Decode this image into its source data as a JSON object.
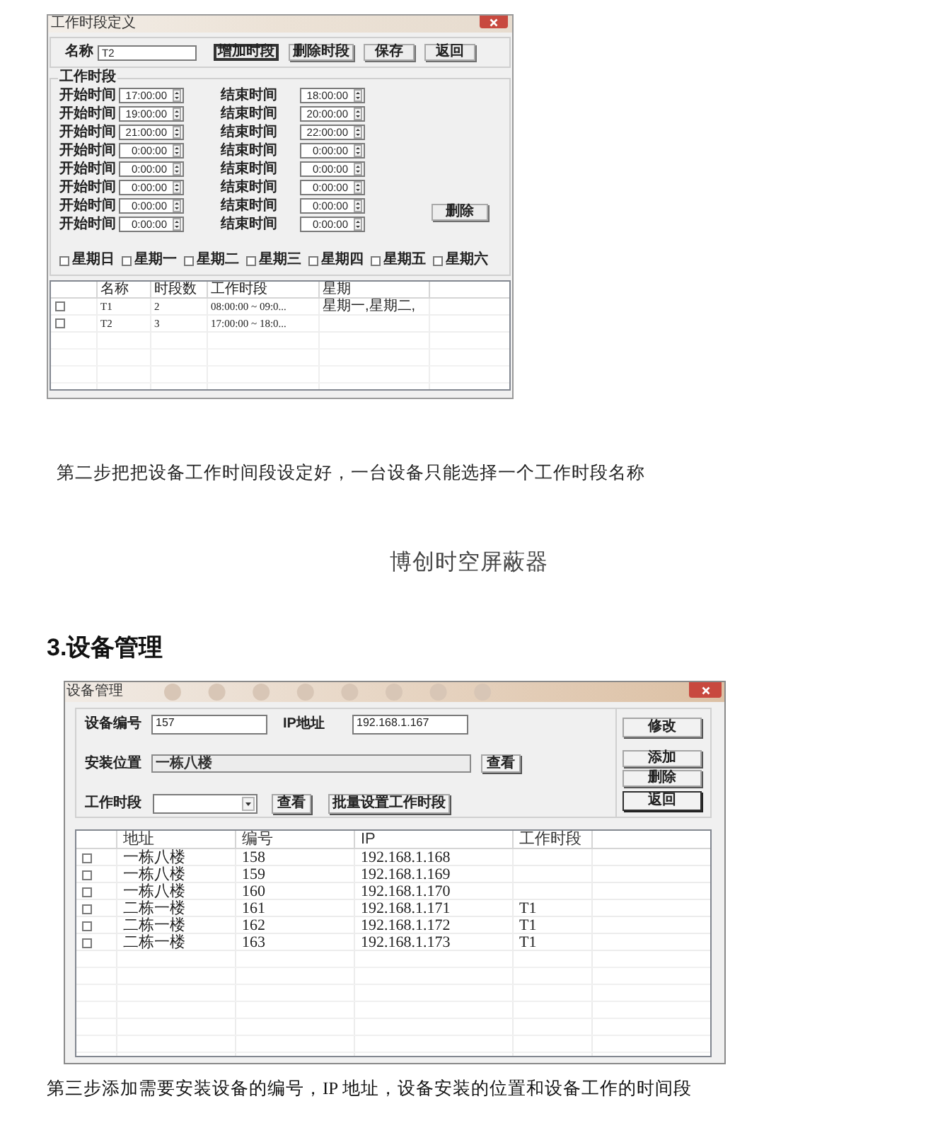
{
  "period_dialog": {
    "title": "工作时段定义",
    "name_label": "名称",
    "name_value": "T2",
    "buttons": [
      {
        "label": "增加时段",
        "default": true
      },
      {
        "label": "删除时段",
        "default": false
      },
      {
        "label": "保存",
        "default": false
      },
      {
        "label": "返回",
        "default": false
      }
    ],
    "group_title": "工作时段",
    "periods": [
      {
        "start_label": "开始时间",
        "start": "17:00:00",
        "end_label": "结束时间",
        "end": "18:00:00"
      },
      {
        "start_label": "开始时间",
        "start": "19:00:00",
        "end_label": "结束时间",
        "end": "20:00:00"
      },
      {
        "start_label": "开始时间",
        "start": "21:00:00",
        "end_label": "结束时间",
        "end": "22:00:00"
      },
      {
        "start_label": "开始时间",
        "start": "0:00:00",
        "end_label": "结束时间",
        "end": "0:00:00"
      },
      {
        "start_label": "开始时间",
        "start": "0:00:00",
        "end_label": "结束时间",
        "end": "0:00:00"
      },
      {
        "start_label": "开始时间",
        "start": "0:00:00",
        "end_label": "结束时间",
        "end": "0:00:00"
      },
      {
        "start_label": "开始时间",
        "start": "0:00:00",
        "end_label": "结束时间",
        "end": "0:00:00"
      },
      {
        "start_label": "开始时间",
        "start": "0:00:00",
        "end_label": "结束时间",
        "end": "0:00:00"
      }
    ],
    "delete_button": "删除",
    "weekdays": [
      {
        "label": "星期日",
        "checked": false
      },
      {
        "label": "星期一",
        "checked": false
      },
      {
        "label": "星期二",
        "checked": false
      },
      {
        "label": "星期三",
        "checked": false
      },
      {
        "label": "星期四",
        "checked": false
      },
      {
        "label": "星期五",
        "checked": false
      },
      {
        "label": "星期六",
        "checked": false
      }
    ],
    "list": {
      "columns": [
        "名称",
        "时段数",
        "工作时段",
        "星期"
      ],
      "rows": [
        {
          "checked": false,
          "name": "T1",
          "period_count": "2",
          "periods": "08:00:00 ~ 09:0...",
          "weekdays": "星期一,星期二,"
        },
        {
          "checked": false,
          "name": "T2",
          "period_count": "3",
          "periods": "17:00:00 ~ 18:0..."
        }
      ]
    }
  },
  "step2_caption": "第二步把把设备工作时间段设定好，一台设备只能选择一个工作时段名称",
  "product_name": "博创时空屏蔽器",
  "section_heading": "3.设备管理",
  "device_dialog": {
    "title": "设备管理",
    "device_number": {
      "label": "设备编号",
      "value": "157"
    },
    "ip_address": {
      "label": "IP地址",
      "value": "192.168.1.167"
    },
    "location": {
      "label": "安装位置",
      "value": "一栋八楼",
      "readonly": true,
      "button": "查看"
    },
    "work_period": {
      "label": "工作时段",
      "button": "查看",
      "batch_button": "批量设置工作时段"
    },
    "side_buttons": [
      {
        "label": "修改",
        "default": false
      },
      {
        "label": "添加",
        "default": false
      },
      {
        "label": "删除",
        "default": false
      },
      {
        "label": "返回",
        "default": true
      }
    ],
    "table": {
      "columns": [
        "地址",
        "编号",
        "IP",
        "工作时段"
      ],
      "rows": [
        {
          "checked": false,
          "address": "一栋八楼",
          "number": "158",
          "ip": "192.168.1.168"
        },
        {
          "checked": false,
          "address": "一栋八楼",
          "number": "159",
          "ip": "192.168.1.169"
        },
        {
          "checked": false,
          "address": "一栋八楼",
          "number": "160",
          "ip": "192.168.1.170"
        },
        {
          "checked": false,
          "address": "二栋一楼",
          "number": "161",
          "ip": "192.168.1.171",
          "work_period": "T1"
        },
        {
          "checked": false,
          "address": "二栋一楼",
          "number": "162",
          "ip": "192.168.1.172",
          "work_period": "T1"
        },
        {
          "checked": false,
          "address": "二栋一楼",
          "number": "163",
          "ip": "192.168.1.173",
          "work_period": "T1"
        }
      ]
    }
  },
  "step3_caption": "第三步添加需要安装设备的编号，IP 地址，设备安装的位置和设备工作的时间段"
}
